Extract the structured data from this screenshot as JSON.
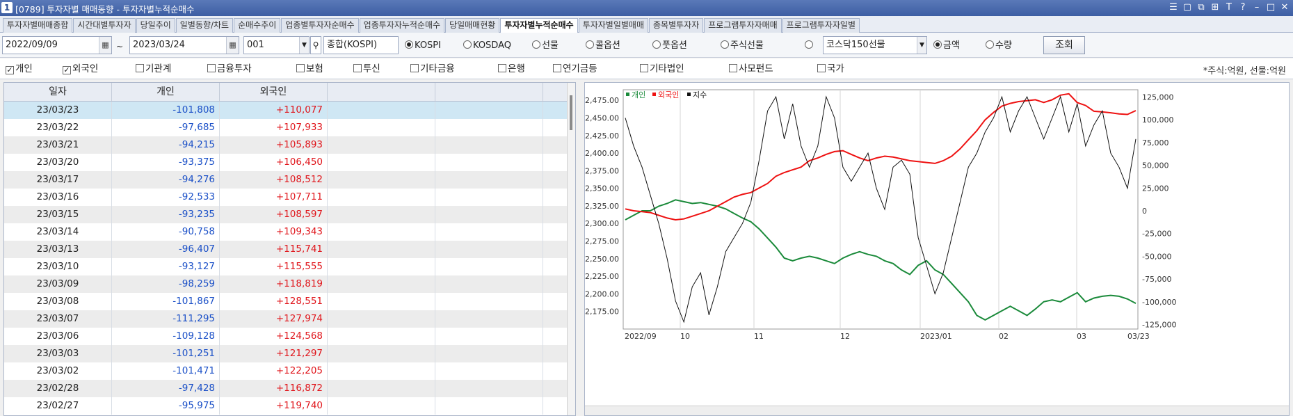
{
  "window": {
    "number": "1",
    "title": "[0789] 투자자별 매매동향 - 투자자별누적순매수",
    "controls": [
      "☰",
      "▢",
      "⧉",
      "⊞",
      "T",
      "?",
      "–",
      "□",
      "✕"
    ]
  },
  "tabs": [
    "투자자별매매종합",
    "시간대별투자자",
    "당일추이",
    "일별동향/차트",
    "순매수추이",
    "업종별투자자순매수",
    "업종투자자누적순매수",
    "당일매매현황",
    "투자자별누적순매수",
    "투자자별일별매매",
    "종목별투자자",
    "프로그램투자자매매",
    "프로그램투자자일별"
  ],
  "active_tab": 8,
  "controls": {
    "start_date": "2022/09/09",
    "tilde": "~",
    "end_date": "2023/03/24",
    "code": "001",
    "code_name": "종합(KOSPI)",
    "market_radios": [
      {
        "label": "KOSPI",
        "on": true
      },
      {
        "label": "KOSDAQ",
        "on": false
      },
      {
        "label": "선물",
        "on": false
      },
      {
        "label": "콜옵션",
        "on": false
      },
      {
        "label": "풋옵션",
        "on": false
      },
      {
        "label": "주식선물",
        "on": false
      },
      {
        "label": "",
        "on": false
      }
    ],
    "futures_select": "코스닥150선물",
    "amount_radios": [
      {
        "label": "금액",
        "on": true
      },
      {
        "label": "수량",
        "on": false
      }
    ],
    "query_button": "조회"
  },
  "investors": [
    {
      "label": "개인",
      "checked": true
    },
    {
      "label": "외국인",
      "checked": true
    },
    {
      "label": "기관계",
      "checked": false
    },
    {
      "label": "금융투자",
      "checked": false
    },
    {
      "label": "보험",
      "checked": false
    },
    {
      "label": "투신",
      "checked": false
    },
    {
      "label": "기타금융",
      "checked": false
    },
    {
      "label": "은행",
      "checked": false
    },
    {
      "label": "연기금등",
      "checked": false
    },
    {
      "label": "기타법인",
      "checked": false
    },
    {
      "label": "사모펀드",
      "checked": false
    },
    {
      "label": "국가",
      "checked": false
    }
  ],
  "unit_note": "*주식:억원, 선물:억원",
  "table": {
    "headers": [
      "일자",
      "개인",
      "외국인",
      "",
      ""
    ],
    "rows": [
      [
        "23/03/23",
        "-101,808",
        "+110,077"
      ],
      [
        "23/03/22",
        "-97,685",
        "+107,933"
      ],
      [
        "23/03/21",
        "-94,215",
        "+105,893"
      ],
      [
        "23/03/20",
        "-93,375",
        "+106,450"
      ],
      [
        "23/03/17",
        "-94,276",
        "+108,512"
      ],
      [
        "23/03/16",
        "-92,533",
        "+107,711"
      ],
      [
        "23/03/15",
        "-93,235",
        "+108,597"
      ],
      [
        "23/03/14",
        "-90,758",
        "+109,343"
      ],
      [
        "23/03/13",
        "-96,407",
        "+115,741"
      ],
      [
        "23/03/10",
        "-93,127",
        "+115,555"
      ],
      [
        "23/03/09",
        "-98,259",
        "+118,819"
      ],
      [
        "23/03/08",
        "-101,867",
        "+128,551"
      ],
      [
        "23/03/07",
        "-111,295",
        "+127,974"
      ],
      [
        "23/03/06",
        "-109,128",
        "+124,568"
      ],
      [
        "23/03/03",
        "-101,251",
        "+121,297"
      ],
      [
        "23/03/02",
        "-101,471",
        "+122,205"
      ],
      [
        "23/02/28",
        "-97,428",
        "+116,872"
      ],
      [
        "23/02/27",
        "-95,975",
        "+119,740"
      ]
    ]
  },
  "chart_data": {
    "type": "line",
    "legend": [
      {
        "name": "개인",
        "color": "#1a8a3a"
      },
      {
        "name": "외국인",
        "color": "#ee1111"
      },
      {
        "name": "지수",
        "color": "#111111"
      }
    ],
    "legend_position": "top-left",
    "x_ticks": [
      "2022/09",
      "10",
      "11",
      "12",
      "2023/01",
      "02",
      "03",
      "03/23"
    ],
    "y_left": {
      "ticks": [
        2175,
        2200,
        2225,
        2250,
        2275,
        2300,
        2325,
        2350,
        2375,
        2400,
        2425,
        2450,
        2475
      ],
      "labels": [
        "2,175.00",
        "2,200.00",
        "2,225.00",
        "2,250.00",
        "2,275.00",
        "2,300.00",
        "2,325.00",
        "2,350.00",
        "2,375.00",
        "2,400.00",
        "2,425.00",
        "2,450.00",
        "2,475.00"
      ],
      "range": [
        2150,
        2490
      ]
    },
    "y_right": {
      "ticks": [
        -125000,
        -100000,
        -75000,
        -50000,
        -25000,
        0,
        25000,
        50000,
        75000,
        100000,
        125000
      ],
      "labels": [
        "-125,000",
        "-100,000",
        "-75,000",
        "-50,000",
        "-25,000",
        "0",
        "25,000",
        "50,000",
        "75,000",
        "100,000",
        "125,000"
      ],
      "range": [
        -130000,
        133000
      ]
    },
    "grid": true,
    "series": [
      {
        "name": "개인",
        "axis": "right",
        "values": [
          -10000,
          -5000,
          0,
          0,
          5000,
          8000,
          12000,
          10000,
          8000,
          9000,
          7000,
          5000,
          2000,
          -3000,
          -8000,
          -12000,
          -20000,
          -30000,
          -40000,
          -52000,
          -55000,
          -52000,
          -50000,
          -52000,
          -55000,
          -58000,
          -52000,
          -48000,
          -45000,
          -48000,
          -50000,
          -55000,
          -58000,
          -65000,
          -70000,
          -60000,
          -55000,
          -65000,
          -70000,
          -80000,
          -90000,
          -100000,
          -115000,
          -120000,
          -115000,
          -110000,
          -105000,
          -110000,
          -115000,
          -108000,
          -100000,
          -98000,
          -100000,
          -95000,
          -90000,
          -100000,
          -96000,
          -94000,
          -93000,
          -94000,
          -97000,
          -101808
        ]
      },
      {
        "name": "외국인",
        "axis": "right",
        "values": [
          2000,
          0,
          -1000,
          -2000,
          -5000,
          -8000,
          -10000,
          -9000,
          -6000,
          -3000,
          0,
          5000,
          10000,
          15000,
          18000,
          20000,
          25000,
          30000,
          38000,
          42000,
          45000,
          48000,
          55000,
          58000,
          62000,
          65000,
          66000,
          62000,
          58000,
          55000,
          58000,
          60000,
          59000,
          57000,
          55000,
          54000,
          53000,
          52000,
          55000,
          60000,
          68000,
          78000,
          88000,
          100000,
          108000,
          115000,
          118000,
          120000,
          121000,
          122000,
          119000,
          122000,
          127000,
          128551,
          118819,
          115741,
          109343,
          108597,
          107711,
          106450,
          105893,
          110077
        ]
      },
      {
        "name": "지수",
        "axis": "left",
        "values": [
          2450,
          2410,
          2380,
          2340,
          2300,
          2250,
          2190,
          2160,
          2210,
          2230,
          2170,
          2210,
          2260,
          2280,
          2300,
          2330,
          2390,
          2460,
          2480,
          2420,
          2470,
          2410,
          2380,
          2410,
          2480,
          2450,
          2380,
          2360,
          2380,
          2400,
          2350,
          2320,
          2380,
          2390,
          2370,
          2280,
          2240,
          2200,
          2230,
          2280,
          2330,
          2380,
          2400,
          2430,
          2450,
          2480,
          2430,
          2460,
          2480,
          2450,
          2420,
          2450,
          2480,
          2430,
          2470,
          2410,
          2440,
          2460,
          2400,
          2380,
          2350,
          2420
        ]
      }
    ]
  }
}
